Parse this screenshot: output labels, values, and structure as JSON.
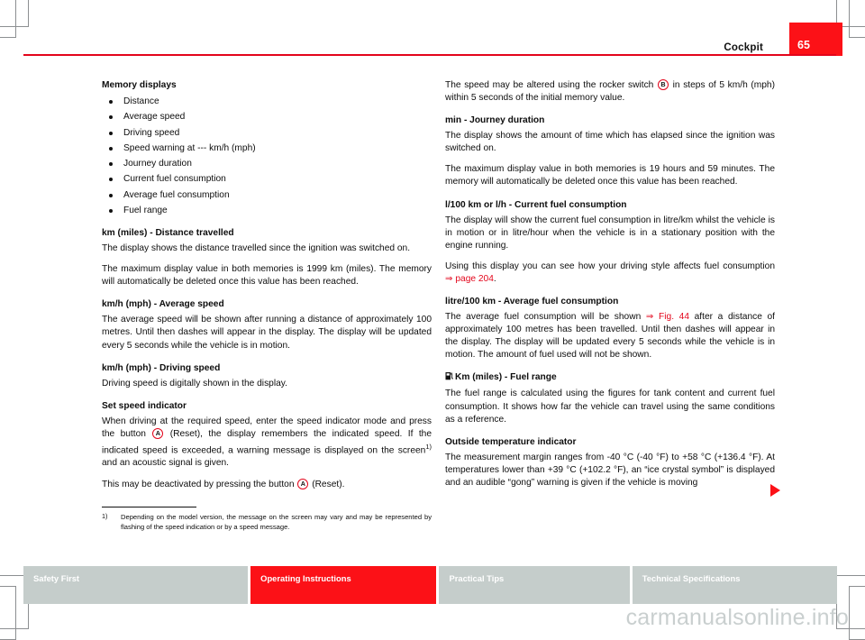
{
  "header": {
    "title": "Cockpit",
    "page_number": "65",
    "accent_color": "#e3051b",
    "badge_color": "#fc1117"
  },
  "left_column": {
    "memory_displays": {
      "heading": "Memory displays",
      "items": [
        "Distance",
        "Average speed",
        "Driving speed",
        "Speed warning at --- km/h (mph)",
        "Journey duration",
        "Current fuel consumption",
        "Average fuel consumption",
        "Fuel range"
      ]
    },
    "distance_travelled": {
      "heading": "km (miles) - Distance travelled",
      "paragraphs": [
        "The display shows the distance travelled since the ignition was switched on.",
        "The maximum display value in both memories is 1999 km (miles). The memory will automatically be deleted once this value has been reached."
      ]
    },
    "average_speed": {
      "heading": "km/h (mph) - Average speed",
      "paragraphs": [
        "The average speed will be shown after running a distance of approximately 100 metres. Until then dashes will appear in the display. The display will be updated every 5 seconds while the vehicle is in motion."
      ]
    },
    "driving_speed": {
      "heading": "km/h (mph) - Driving speed",
      "paragraphs": [
        "Driving speed is digitally shown in the display."
      ]
    },
    "set_speed_indicator": {
      "heading": "Set speed indicator",
      "para1_part1": "When driving at the required speed, enter the speed indicator mode and press the button",
      "badge_a": "A",
      "para1_part2": "(Reset), the display remembers the indicated speed. If the indicated speed is exceeded, a warning message is displayed on the screen",
      "footnote_marker": "1)",
      "para1_part3": "and an acoustic signal is given.",
      "para2_part1": "This may be deactivated by pressing the button",
      "para2_part2": "(Reset)."
    }
  },
  "footnote": {
    "marker": "1)",
    "text": "Depending on the model version, the message on the screen may vary and may be represented by flashing of the speed indication or by a speed message."
  },
  "right_column": {
    "rocker_switch": {
      "part1": "The speed may be altered using the rocker switch",
      "badge_b": "B",
      "part2": "in steps of 5 km/h (mph) within 5 seconds of the initial memory value."
    },
    "journey_duration": {
      "heading": "min - Journey duration",
      "paragraphs": [
        "The display shows the amount of time which has elapsed since the ignition was switched on.",
        "The maximum display value in both memories is 19 hours and 59 minutes. The memory will automatically be deleted once this value has been reached."
      ]
    },
    "current_fuel_consumption": {
      "heading": "l/100 km or l/h - Current fuel consumption",
      "para1": "The display will show the current fuel consumption in litre/km whilst the vehicle is in motion or in litre/hour when the vehicle is in a stationary position with the engine running.",
      "para2_part1": "Using this display you can see how your driving style affects fuel consumption",
      "para2_xref": "⇒ page 204",
      "para2_part2": "."
    },
    "average_fuel_consumption": {
      "heading": "litre/100 km - Average fuel consumption",
      "para_part1": "The average fuel consumption will be shown",
      "para_xref": "⇒ Fig. 44",
      "para_part2": "after a distance of approximately 100 metres has been travelled. Until then dashes will appear in the display. The display will be updated every 5 seconds while the vehicle is in motion. The amount of fuel used will not be shown."
    },
    "fuel_range": {
      "icon": "fuel-pump-icon",
      "heading": "Km (miles) - Fuel range",
      "paragraphs": [
        "The fuel range is calculated using the figures for tank content and current fuel consumption. It shows how far the vehicle can travel using the same conditions as a reference."
      ]
    },
    "outside_temperature": {
      "heading": "Outside temperature indicator",
      "paragraphs": [
        "The measurement margin ranges from -40 °C (-40 °F) to +58 °C (+136.4 °F). At temperatures lower than +39 °C (+102.2 °F), an “ice crystal symbol” is displayed and an audible “gong” warning is given if the vehicle is moving"
      ]
    }
  },
  "footer": {
    "tabs": [
      {
        "label": "Safety First",
        "active": false
      },
      {
        "label": "Operating Instructions",
        "active": true
      },
      {
        "label": "Practical Tips",
        "active": false
      },
      {
        "label": "Technical Specifications",
        "active": false
      }
    ]
  },
  "watermark": {
    "text": "carmanualsonline.info"
  }
}
